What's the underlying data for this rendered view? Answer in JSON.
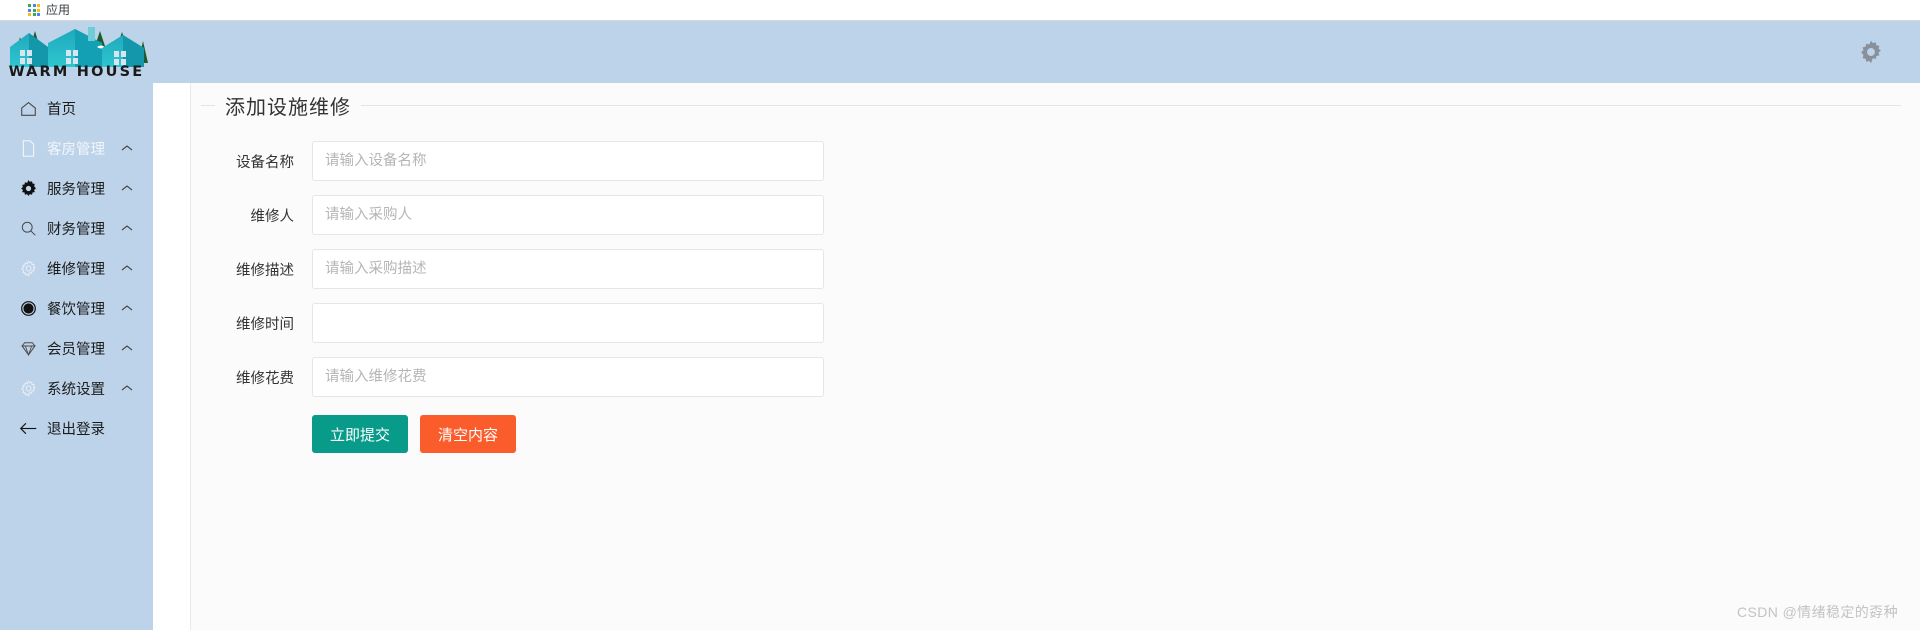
{
  "browser": {
    "bookmark": {
      "icon": "apps-grid-icon",
      "label": "应用",
      "grid_colors": [
        "#34a853",
        "#4285f4",
        "#fbbc05",
        "#4285f4",
        "#34a853",
        "#fbbc05",
        "#fbbc05",
        "#34a853",
        "#4285f4"
      ]
    }
  },
  "colors": {
    "sidebar_bg": "#bdd3ea",
    "topbar_bg": "#bdd3ea",
    "content_bg": "#fbfbfb",
    "submit_btn": "#089b8a",
    "clear_btn": "#fb5c2c",
    "text": "#333333",
    "placeholder": "#b5b5b5"
  },
  "sidebar": {
    "logo": {
      "brand": "WARM HOUSE",
      "icon": "warm-house-logo"
    },
    "items": [
      {
        "label": "首页",
        "icon": "home-icon",
        "caret": false,
        "muted": false
      },
      {
        "label": "客房管理",
        "icon": "document-icon",
        "caret": true,
        "muted": true
      },
      {
        "label": "服务管理",
        "icon": "gear-solid-icon",
        "caret": true,
        "muted": false
      },
      {
        "label": "财务管理",
        "icon": "search-icon",
        "caret": true,
        "muted": false
      },
      {
        "label": "维修管理",
        "icon": "gear-outline-icon",
        "caret": true,
        "muted": false
      },
      {
        "label": "餐饮管理",
        "icon": "circle-dot-icon",
        "caret": true,
        "muted": false
      },
      {
        "label": "会员管理",
        "icon": "diamond-icon",
        "caret": true,
        "muted": false
      },
      {
        "label": "系统设置",
        "icon": "gear-outline-icon",
        "caret": true,
        "muted": false
      },
      {
        "label": "退出登录",
        "icon": "arrow-left-icon",
        "caret": false,
        "muted": false
      }
    ]
  },
  "topbar": {
    "settings_icon": "gear-icon"
  },
  "main": {
    "panel_title": "添加设施维修",
    "fields": [
      {
        "label": "设备名称",
        "placeholder": "请输入设备名称",
        "value": "",
        "name": "equipment-name"
      },
      {
        "label": "维修人",
        "placeholder": "请输入采购人",
        "value": "",
        "name": "repair-person"
      },
      {
        "label": "维修描述",
        "placeholder": "请输入采购描述",
        "value": "",
        "name": "repair-description"
      },
      {
        "label": "维修时间",
        "placeholder": "",
        "value": "",
        "name": "repair-time"
      },
      {
        "label": "维修花费",
        "placeholder": "请输入维修花费",
        "value": "",
        "name": "repair-cost"
      }
    ],
    "buttons": {
      "submit": "立即提交",
      "clear": "清空内容"
    }
  },
  "watermark": "CSDN @情绪稳定的孬种"
}
